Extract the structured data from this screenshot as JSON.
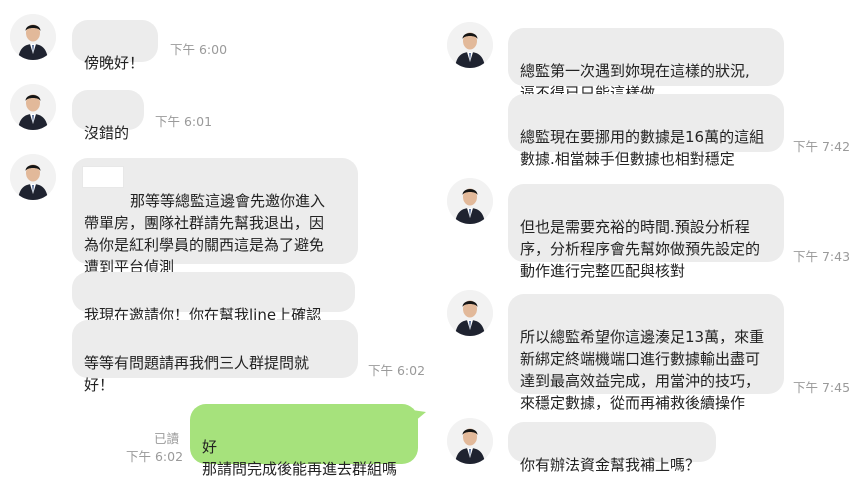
{
  "colors": {
    "incoming_bubble": "#ececec",
    "outgoing_bubble": "#a6e27c",
    "time_text": "#9a9a9a",
    "background": "#ffffff"
  },
  "left": {
    "messages": [
      {
        "text": "傍晚好！",
        "time": "下午 6:00"
      },
      {
        "text": "沒錯的",
        "time": "下午 6:01"
      },
      {
        "text": "那等等總監這邊會先邀你進入\n帶單房，團隊社群請先幫我退出，因\n為你是紅利學員的關西這是為了避免\n遭到平台偵測"
      },
      {
        "text": "我現在邀請你！你在幫我line上確認"
      },
      {
        "text": "等等有問題請再我們三人群提問就\n好！",
        "time": "下午 6:02"
      }
    ],
    "outgoing": {
      "text": "好\n那請問完成後能再進去群組嗎",
      "read": "已讀",
      "time": "下午 6:02"
    }
  },
  "right": {
    "messages": [
      {
        "text": "總監第一次遇到妳現在這樣的狀況,\n逼不得已只能這樣做"
      },
      {
        "text": "總監現在要挪用的數據是16萬的這組\n數據.相當棘手但數據也相對穩定",
        "time": "下午 7:42"
      },
      {
        "text": "但也是需要充裕的時間.預設分析程\n序，分析程序會先幫妳做預先設定的\n動作進行完整匹配與核對",
        "time": "下午 7:43"
      },
      {
        "text": "所以總監希望你這邊湊足13萬，來重\n新綁定終端機端口進行數據輸出盡可\n達到最高效益完成，用當沖的技巧，\n來穩定數據，從而再補救後續操作",
        "time": "下午 7:45"
      },
      {
        "text": "你有辦法資金幫我補上嗎？"
      }
    ]
  },
  "icons": {
    "avatar": "profile-photo-man-in-suit"
  }
}
